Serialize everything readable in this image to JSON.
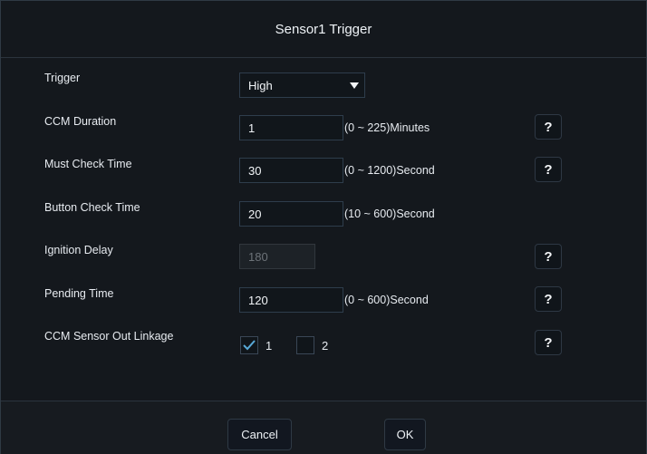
{
  "dialog": {
    "title": "Sensor1 Trigger"
  },
  "fields": {
    "trigger": {
      "label": "Trigger",
      "value": "High"
    },
    "ccm_duration": {
      "label": "CCM Duration",
      "value": "1",
      "range": "(0 ~ 225)Minutes"
    },
    "must_check_time": {
      "label": "Must Check Time",
      "value": "30",
      "range": "(0 ~ 1200)Second"
    },
    "button_check_time": {
      "label": "Button Check Time",
      "value": "20",
      "range": "(10 ~ 600)Second"
    },
    "ignition_delay": {
      "label": "Ignition Delay",
      "value": "180"
    },
    "pending_time": {
      "label": "Pending Time",
      "value": "120",
      "range": "(0 ~ 600)Second"
    },
    "ccm_sensor_out_linkage": {
      "label": "CCM Sensor Out Linkage",
      "options": [
        {
          "label": "1",
          "checked": true
        },
        {
          "label": "2",
          "checked": false
        }
      ]
    }
  },
  "help_icon": {
    "glyph": "?",
    "name": "help-icon"
  },
  "buttons": {
    "cancel": "Cancel",
    "ok": "OK"
  },
  "colors": {
    "background": "#14181d",
    "border": "#2e3d4c",
    "text": "#e7ebf0",
    "checkmark": "#58a9d7"
  }
}
